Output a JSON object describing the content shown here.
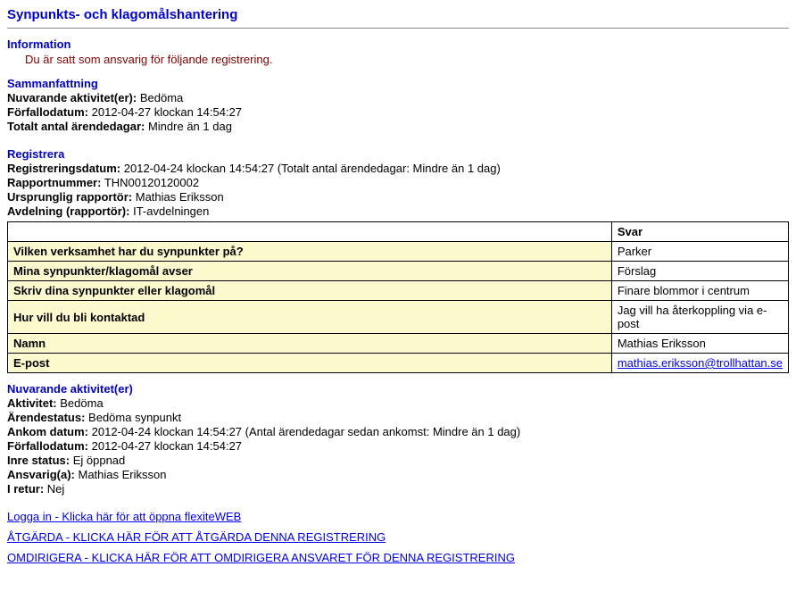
{
  "pageTitle": "Synpunkts- och klagomålshantering",
  "info": {
    "header": "Information",
    "message": "Du är satt som ansvarig för följande registrering."
  },
  "summary": {
    "header": "Sammanfattning",
    "currentActivitiesLabel": "Nuvarande aktivitet(er):",
    "currentActivitiesValue": "Bedöma",
    "dueDateLabel": "Förfallodatum:",
    "dueDateValue": "2012-04-27 klockan 14:54:27",
    "totalDaysLabel": "Totalt antal ärendedagar:",
    "totalDaysValue": "Mindre än 1 dag"
  },
  "register": {
    "header": "Registrera",
    "regDateLabel": "Registreringsdatum:",
    "regDateValue": "2012-04-24 klockan 14:54:27 (Totalt antal ärendedagar: Mindre än 1 dag)",
    "reportNumLabel": "Rapportnummer:",
    "reportNumValue": "THN00120120002",
    "origReporterLabel": "Ursprunglig rapportör:",
    "origReporterValue": "Mathias Eriksson",
    "deptLabel": "Avdelning (rapportör):",
    "deptValue": "IT-avdelningen"
  },
  "table": {
    "answerHeader": "Svar",
    "rows": [
      {
        "q": "Vilken verksamhet har du synpunkter på?",
        "a": "Parker"
      },
      {
        "q": "Mina synpunkter/klagomål avser",
        "a": "Förslag"
      },
      {
        "q": "Skriv dina synpunkter eller klagomål",
        "a": "Finare blommor i centrum"
      },
      {
        "q": "Hur vill du bli kontaktad",
        "a": "Jag vill ha återkoppling via e-post"
      },
      {
        "q": "Namn",
        "a": "Mathias Eriksson"
      }
    ],
    "emailRow": {
      "q": "E-post",
      "a": "mathias.eriksson@trollhattan.se"
    }
  },
  "current": {
    "header": "Nuvarande aktivitet(er)",
    "activityLabel": "Aktivitet:",
    "activityValue": "Bedöma",
    "statusLabel": "Ärendestatus:",
    "statusValue": "Bedöma synpunkt",
    "arrivedLabel": "Ankom datum:",
    "arrivedValue": "2012-04-24 klockan 14:54:27 (Antal ärendedagar sedan ankomst: Mindre än 1 dag)",
    "dueLabel": "Förfallodatum:",
    "dueValue": "2012-04-27 klockan 14:54:27",
    "innerStatusLabel": "Inre status:",
    "innerStatusValue": "Ej öppnad",
    "responsibleLabel": "Ansvarig(a):",
    "responsibleValue": "Mathias Eriksson",
    "returnLabel": "I retur:",
    "returnValue": "Nej"
  },
  "links": {
    "login": "Logga in - Klicka här för att öppna flexiteWEB",
    "action": "ÅTGÄRDA - KLICKA HÄR FÖR ATT ÅTGÄRDA DENNA REGISTRERING",
    "redirect": "OMDIRIGERA - KLICKA HÄR FÖR ATT OMDIRIGERA ANSVARET FÖR DENNA REGISTRERING"
  }
}
